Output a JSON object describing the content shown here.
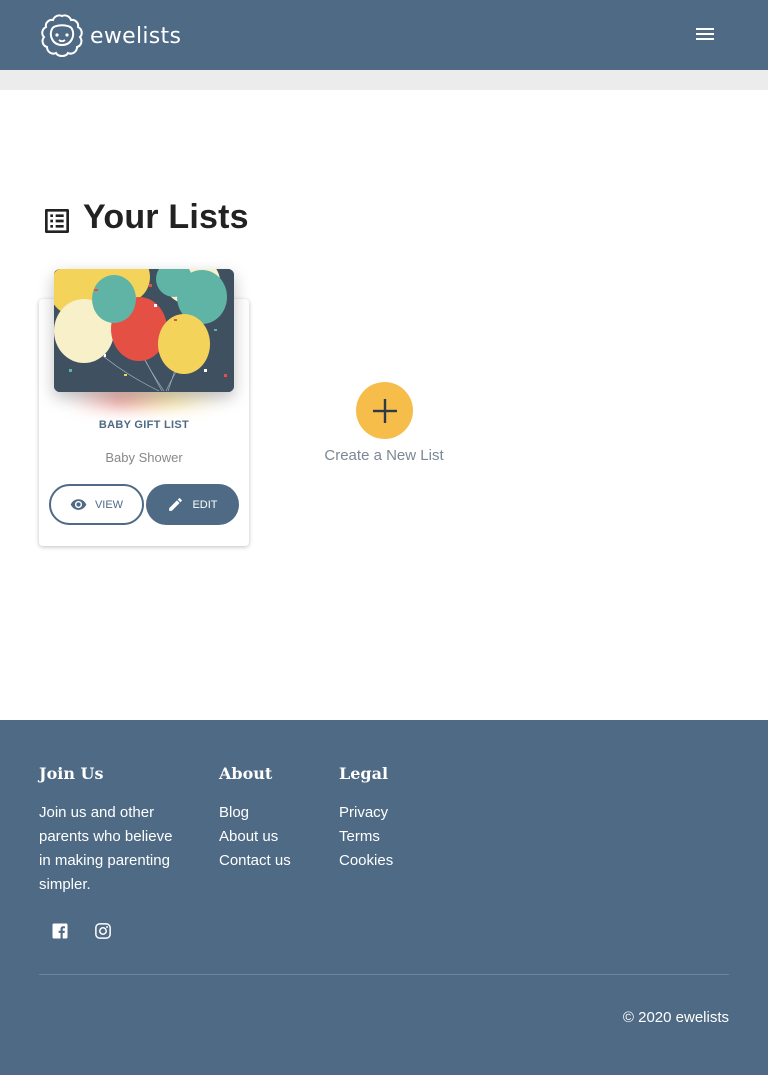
{
  "header": {
    "brand": "ewelists",
    "menu_icon": "menu-icon"
  },
  "main": {
    "title": "Your Lists",
    "title_icon": "list-icon"
  },
  "list_card": {
    "category": "BABY GIFT LIST",
    "subtitle": "Baby Shower",
    "view_label": "VIEW",
    "edit_label": "EDIT",
    "view_icon": "eye-icon",
    "edit_icon": "pencil-icon"
  },
  "create": {
    "label": "Create a New List",
    "icon": "plus-icon"
  },
  "footer": {
    "join_heading": "Join Us",
    "join_lines": [
      "Join us and other",
      "parents who believe",
      "in making parenting",
      "simpler."
    ],
    "about_heading": "About",
    "about_links": [
      "Blog",
      "About us",
      "Contact us"
    ],
    "legal_heading": "Legal",
    "legal_links": [
      "Privacy",
      "Terms",
      "Cookies"
    ],
    "social": [
      "facebook-icon",
      "instagram-icon"
    ],
    "copyright": "© 2020 ewelists"
  },
  "colors": {
    "primary": "#4e6a84",
    "accent": "#f6bd4b"
  }
}
